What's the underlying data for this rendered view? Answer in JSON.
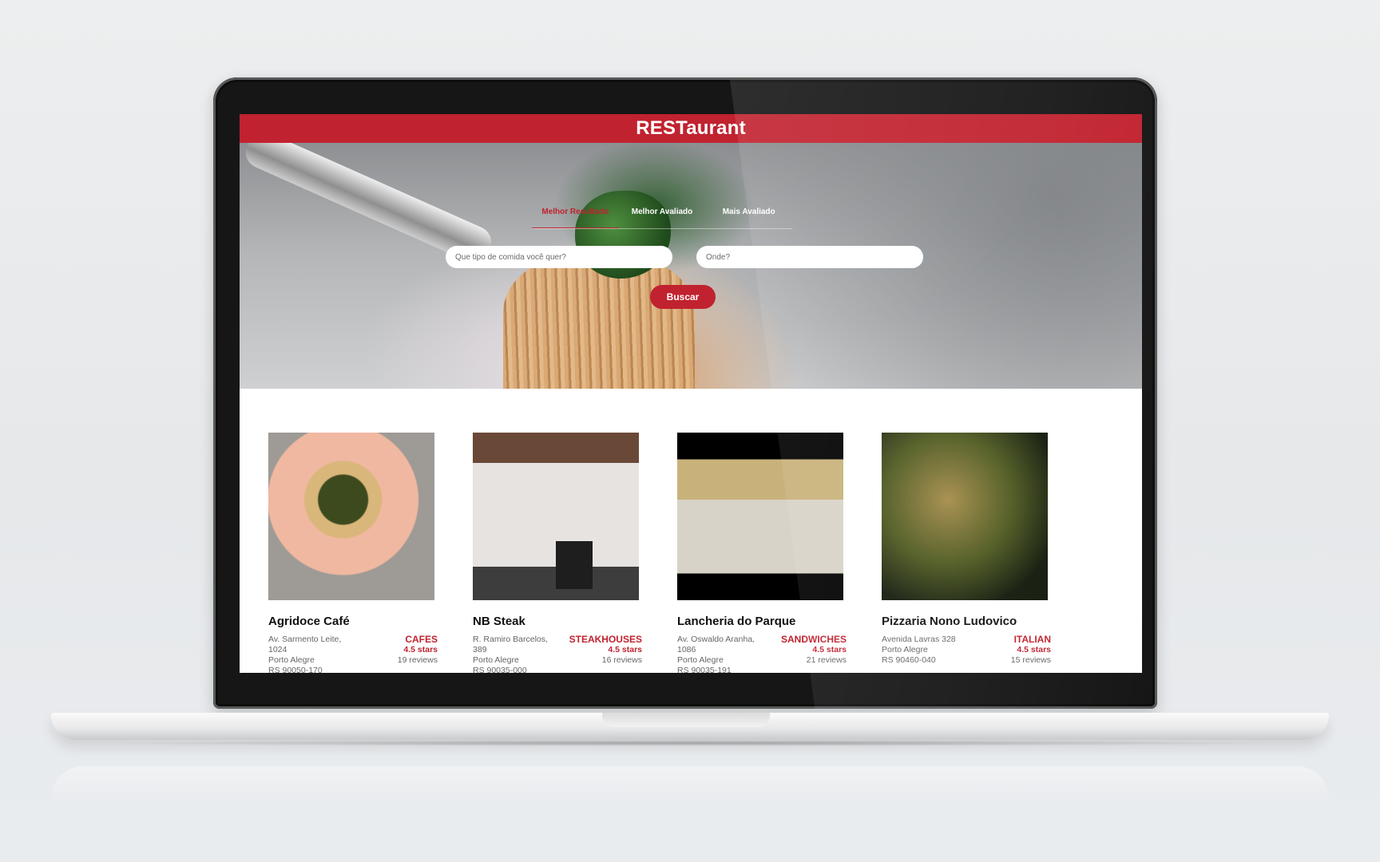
{
  "app": {
    "brand": "RESTaurant",
    "brand_color": "#c1222f"
  },
  "hero": {
    "tabs": [
      {
        "label": "Melhor Resultado",
        "active": true
      },
      {
        "label": "Melhor Avaliado",
        "active": false
      },
      {
        "label": "Mais Avaliado",
        "active": false
      }
    ],
    "food_search": {
      "placeholder": "Que tipo de comida você quer?"
    },
    "location_search": {
      "placeholder": "Onde?"
    },
    "search_button": "Buscar"
  },
  "restaurants": [
    {
      "name": "Agridoce Café",
      "address": "Av. Sarmento Leite, 1024",
      "city": "Porto Alegre",
      "zip": "RS 90050-170",
      "category": "CAFES",
      "rating": "4.5 stars",
      "reviews": "19 reviews"
    },
    {
      "name": "NB Steak",
      "address": "R. Ramiro Barcelos, 389",
      "city": "Porto Alegre",
      "zip": "RS 90035-000",
      "category": "STEAKHOUSES",
      "rating": "4.5 stars",
      "reviews": "16 reviews"
    },
    {
      "name": "Lancheria do Parque",
      "address": "Av. Oswaldo Aranha, 1086",
      "city": "Porto Alegre",
      "zip": "RS 90035-191",
      "category": "SANDWICHES",
      "rating": "4.5 stars",
      "reviews": "21 reviews"
    },
    {
      "name": "Pizzaria Nono Ludovico",
      "address": "Avenida Lavras 328",
      "city": "Porto Alegre",
      "zip": "RS 90460-040",
      "category": "ITALIAN",
      "rating": "4.5 stars",
      "reviews": "15 reviews"
    }
  ]
}
